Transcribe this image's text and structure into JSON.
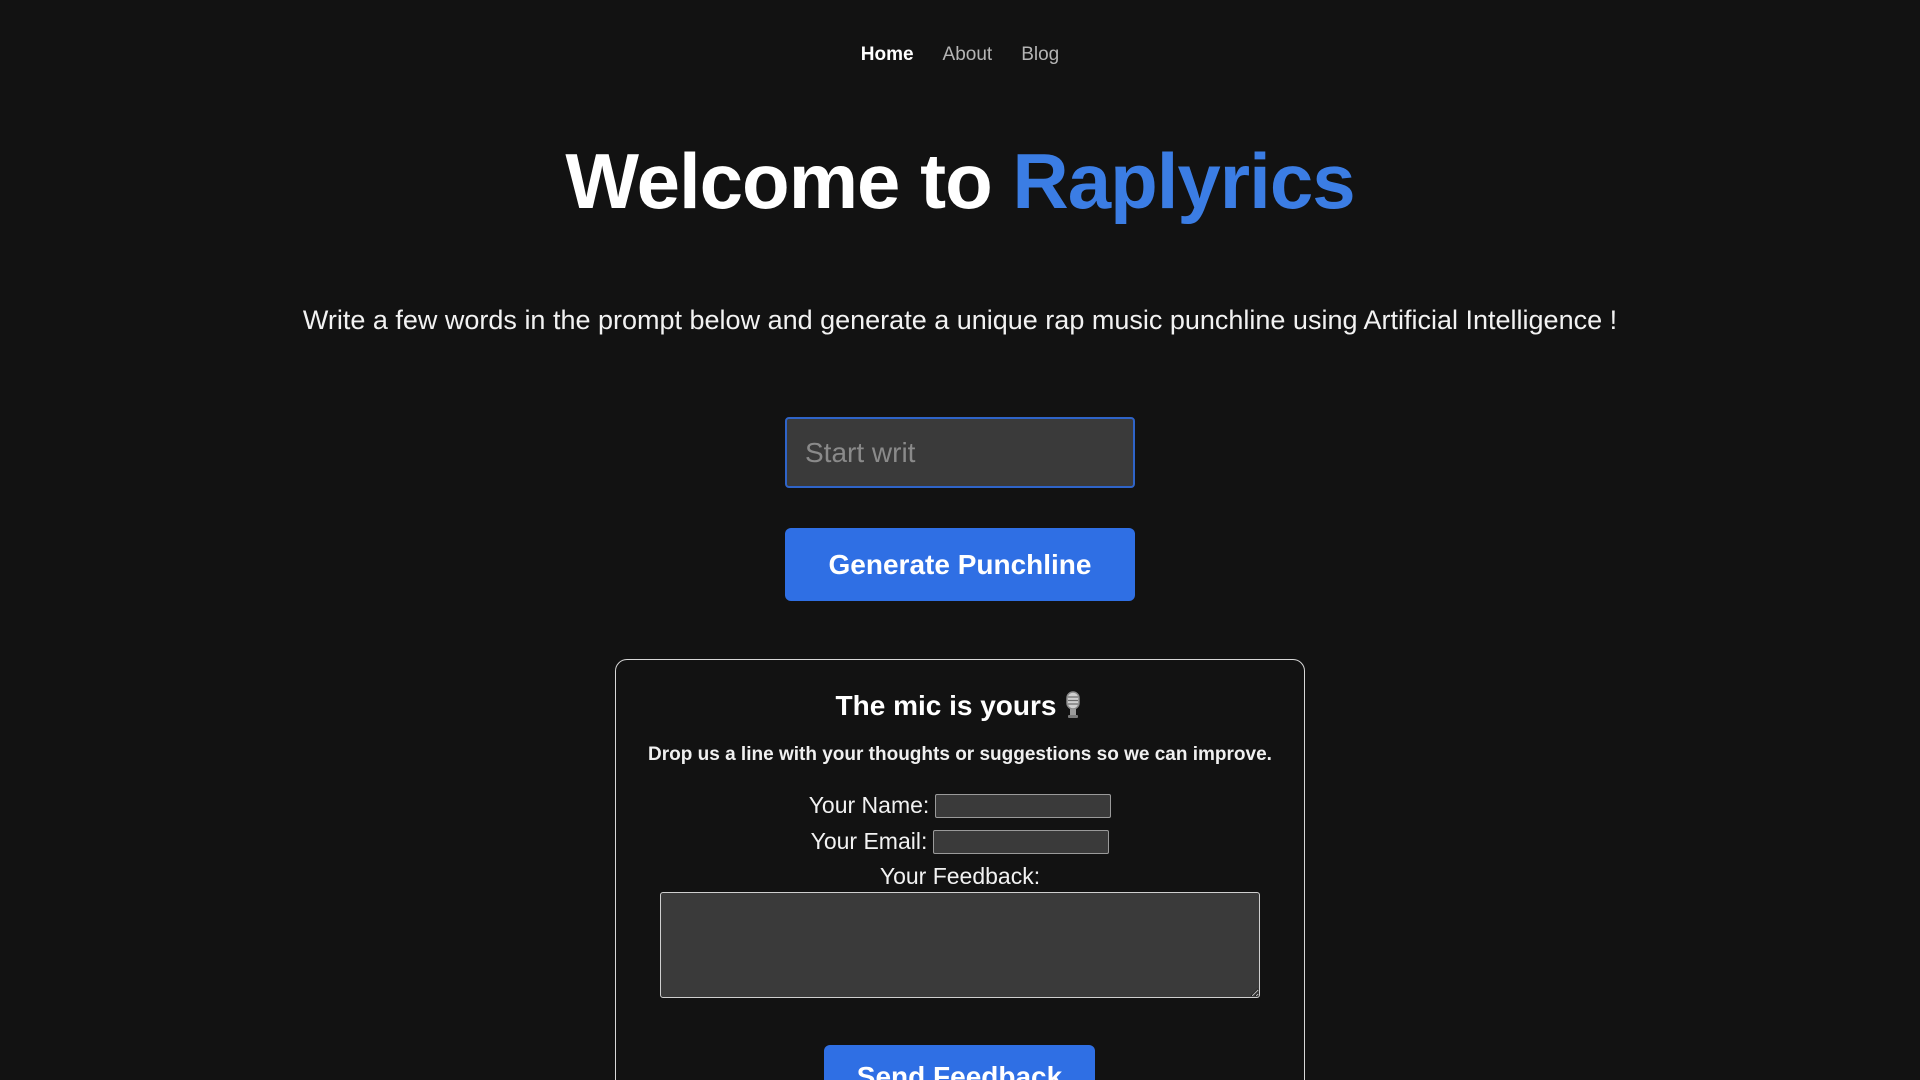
{
  "nav": {
    "items": [
      {
        "label": "Home",
        "active": true
      },
      {
        "label": "About",
        "active": false
      },
      {
        "label": "Blog",
        "active": false
      }
    ]
  },
  "hero": {
    "title_prefix": "Welcome to ",
    "title_brand": "Raplyrics",
    "subtitle": "Write a few words in the prompt below and generate a unique rap music punchline using Artificial Intelligence !"
  },
  "prompt": {
    "placeholder": "Start writ",
    "value": "",
    "button_label": "Generate Punchline"
  },
  "feedback": {
    "title": "The mic is yours",
    "title_icon": "microphone-icon",
    "description": "Drop us a line with your thoughts or suggestions so we can improve.",
    "name_label": "Your Name:",
    "email_label": "Your Email:",
    "feedback_label": "Your Feedback:",
    "button_label": "Send Feedback"
  },
  "colors": {
    "background": "#121212",
    "accent": "#2f6fe4",
    "brand_text": "#3b7de4"
  }
}
